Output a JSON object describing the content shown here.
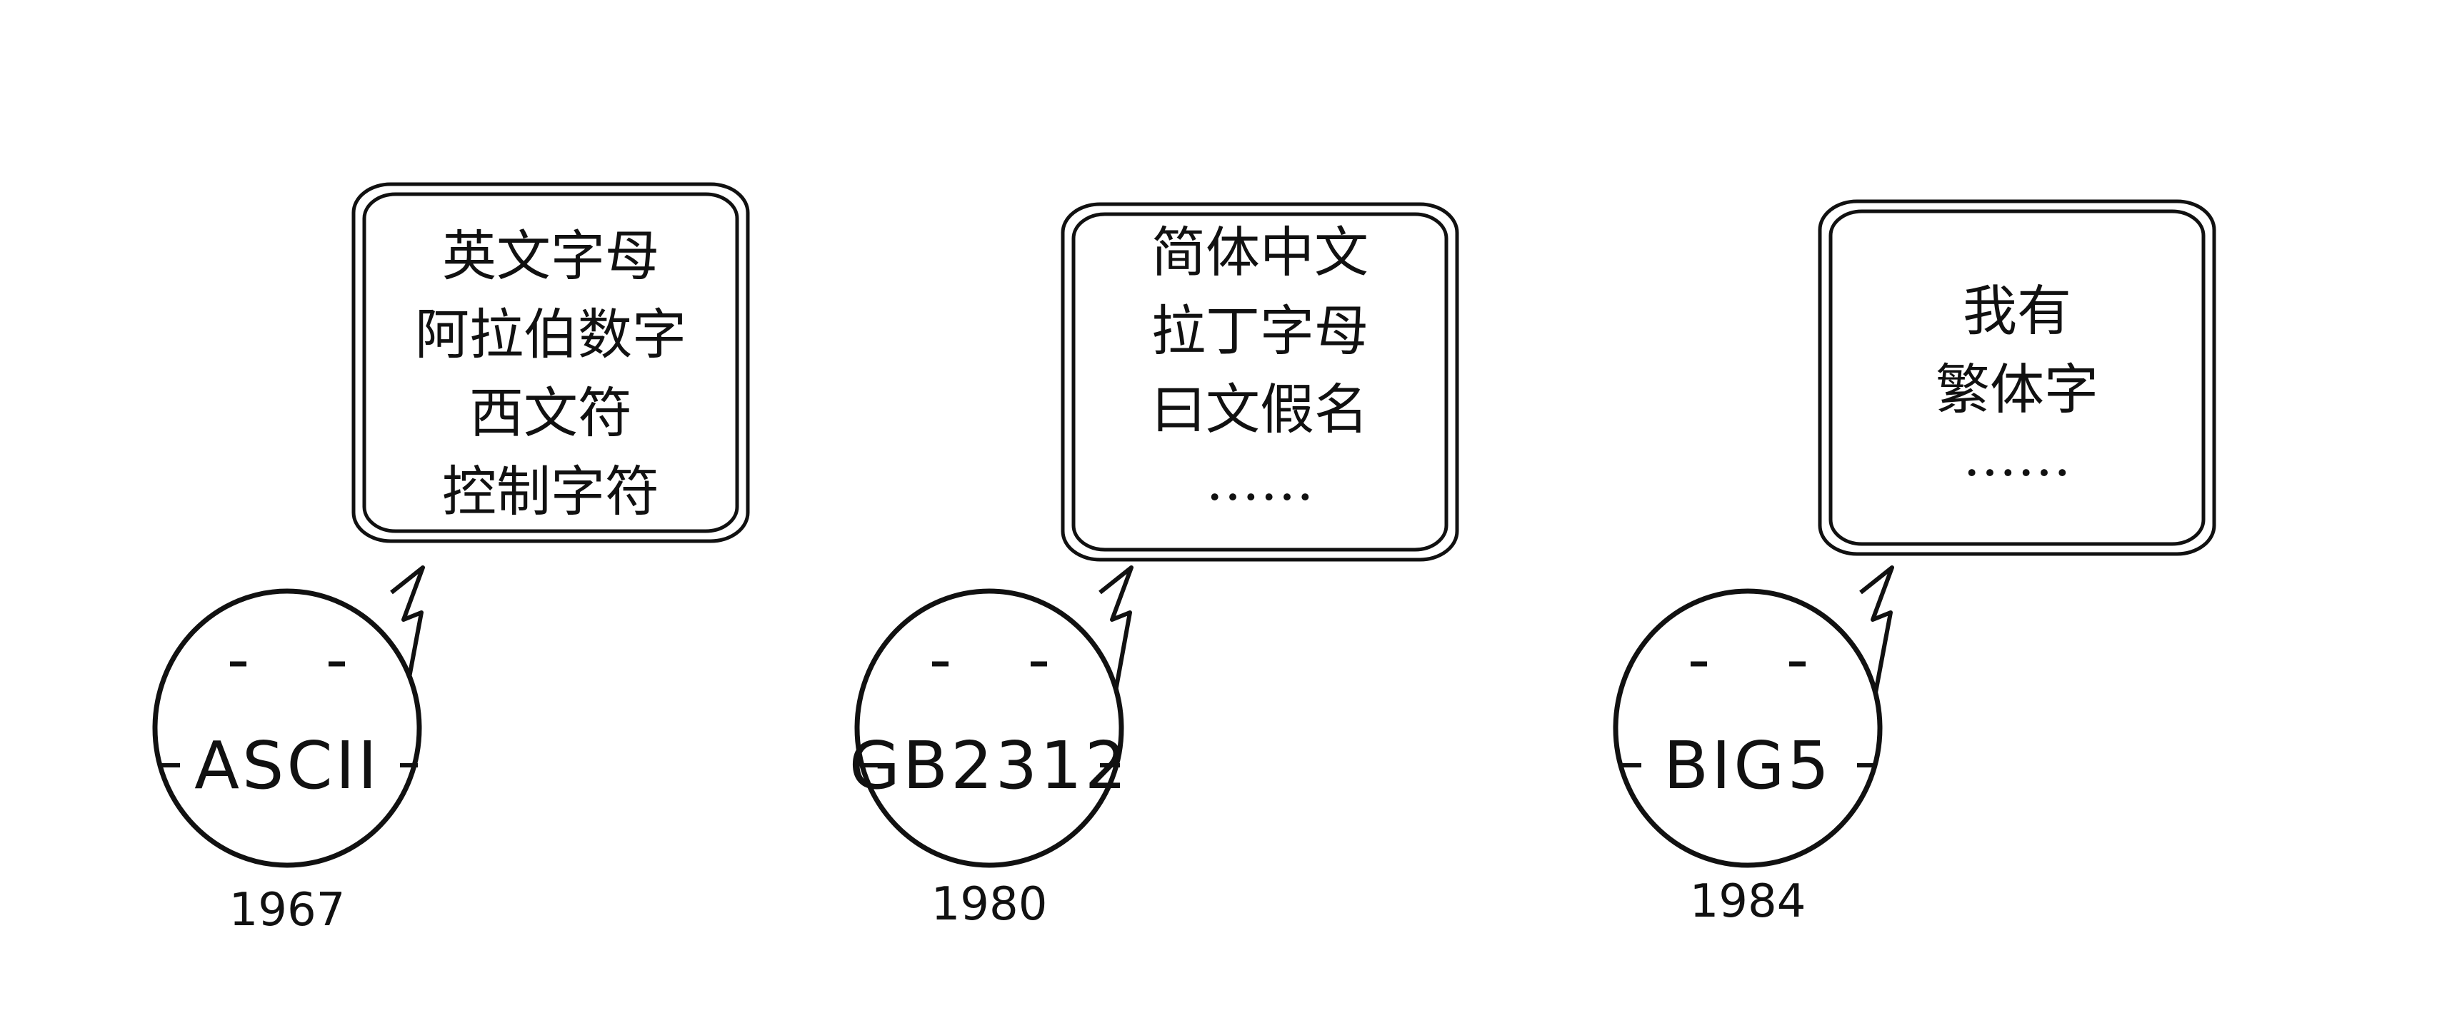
{
  "characters": [
    {
      "name": "ASCII",
      "year": "1967",
      "speech": [
        "英文字母",
        "阿拉伯数字",
        "西文符",
        "控制字符"
      ]
    },
    {
      "name": "GB2312",
      "year": "1980",
      "speech": [
        "简体中文",
        "拉丁字母",
        "曰文假名",
        "……"
      ]
    },
    {
      "name": "BIG5",
      "year": "1984",
      "speech": [
        "我有",
        "繁体字",
        "……"
      ]
    }
  ]
}
